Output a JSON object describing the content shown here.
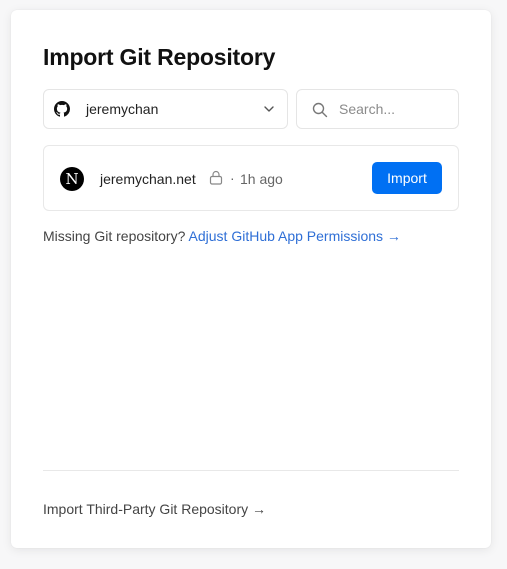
{
  "header": {
    "title": "Import Git Repository"
  },
  "account": {
    "name": "jeremychan",
    "icon": "github-icon"
  },
  "search": {
    "placeholder": "Search...",
    "value": ""
  },
  "repositories": [
    {
      "avatar_letter": "N",
      "name": "jeremychan.net",
      "visibility_icon": "lock-icon",
      "separator": "·",
      "updated": "1h ago",
      "action_label": "Import"
    }
  ],
  "missing": {
    "text": "Missing Git repository?",
    "link_label": "Adjust GitHub App Permissions →"
  },
  "footer": {
    "third_party_label": "Import Third-Party Git Repository →"
  },
  "colors": {
    "accent": "#0070f3",
    "link": "#2f6fd6",
    "border": "#e5e5e5"
  }
}
